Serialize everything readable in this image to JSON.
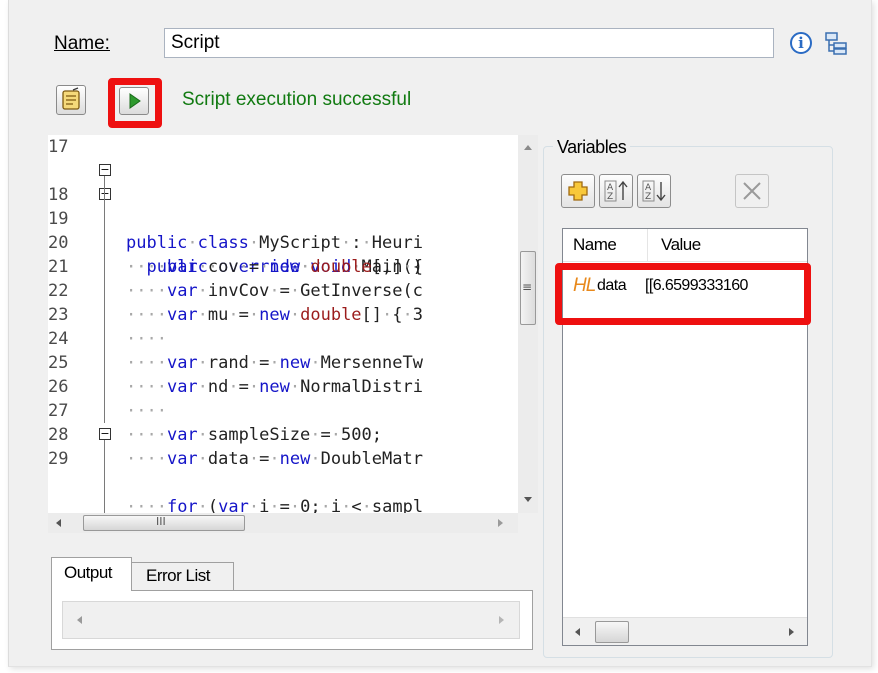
{
  "header": {
    "name_label": "Name:",
    "name_value": "Script",
    "info_icon": "info-icon",
    "tree_icon": "structure-icon"
  },
  "toolbar": {
    "compile_icon": "compile-script-icon",
    "run_icon": "run-play-icon",
    "status": "Script execution successful",
    "status_color": "#117a11",
    "highlight_color": "#ee1010"
  },
  "editor": {
    "lines": [
      {
        "num": "17",
        "fold": "",
        "code": ""
      },
      {
        "num": "18",
        "fold": "−",
        "code": "public·class·MyScript·:·Heuri"
      },
      {
        "num": "19",
        "fold": "−",
        "code": "··public·override·void·Main()"
      },
      {
        "num": "20",
        "fold": "",
        "code": "····var·cov·=·new·double[,]·{"
      },
      {
        "num": "21",
        "fold": "",
        "code": "····var·invCov·=·GetInverse(c"
      },
      {
        "num": "22",
        "fold": "",
        "code": "····var·mu·=·new·double[]·{·3"
      },
      {
        "num": "23",
        "fold": "",
        "code": "····"
      },
      {
        "num": "24",
        "fold": "",
        "code": "····var·rand·=·new·MersenneTw"
      },
      {
        "num": "25",
        "fold": "",
        "code": "····var·nd·=·new·NormalDistri"
      },
      {
        "num": "26",
        "fold": "",
        "code": "····"
      },
      {
        "num": "27",
        "fold": "",
        "code": "····var·sampleSize·=·500;"
      },
      {
        "num": "28",
        "fold": "",
        "code": "····var·data·=·new·DoubleMatr"
      },
      {
        "num": "29",
        "fold": "−",
        "code": "····for·(var·i·=·0;·i·<·sampl"
      }
    ],
    "hscroll_grip": "III",
    "vscroll_grip": "≡"
  },
  "output": {
    "tabs": [
      "Output",
      "Error List"
    ]
  },
  "variables": {
    "group_title": "Variables",
    "buttons": [
      {
        "icon": "add-variable-icon",
        "glyph": "+"
      },
      {
        "icon": "sort-ascending-icon",
        "glyph": "A↑"
      },
      {
        "icon": "sort-descending-icon",
        "glyph": "Z↓"
      },
      {
        "icon": "remove-variable-icon",
        "glyph": "✕"
      }
    ],
    "columns": [
      "Name",
      "Value"
    ],
    "rows": [
      {
        "type_icon": "HL",
        "name": "data",
        "value": "[[6.6599333160"
      }
    ]
  }
}
